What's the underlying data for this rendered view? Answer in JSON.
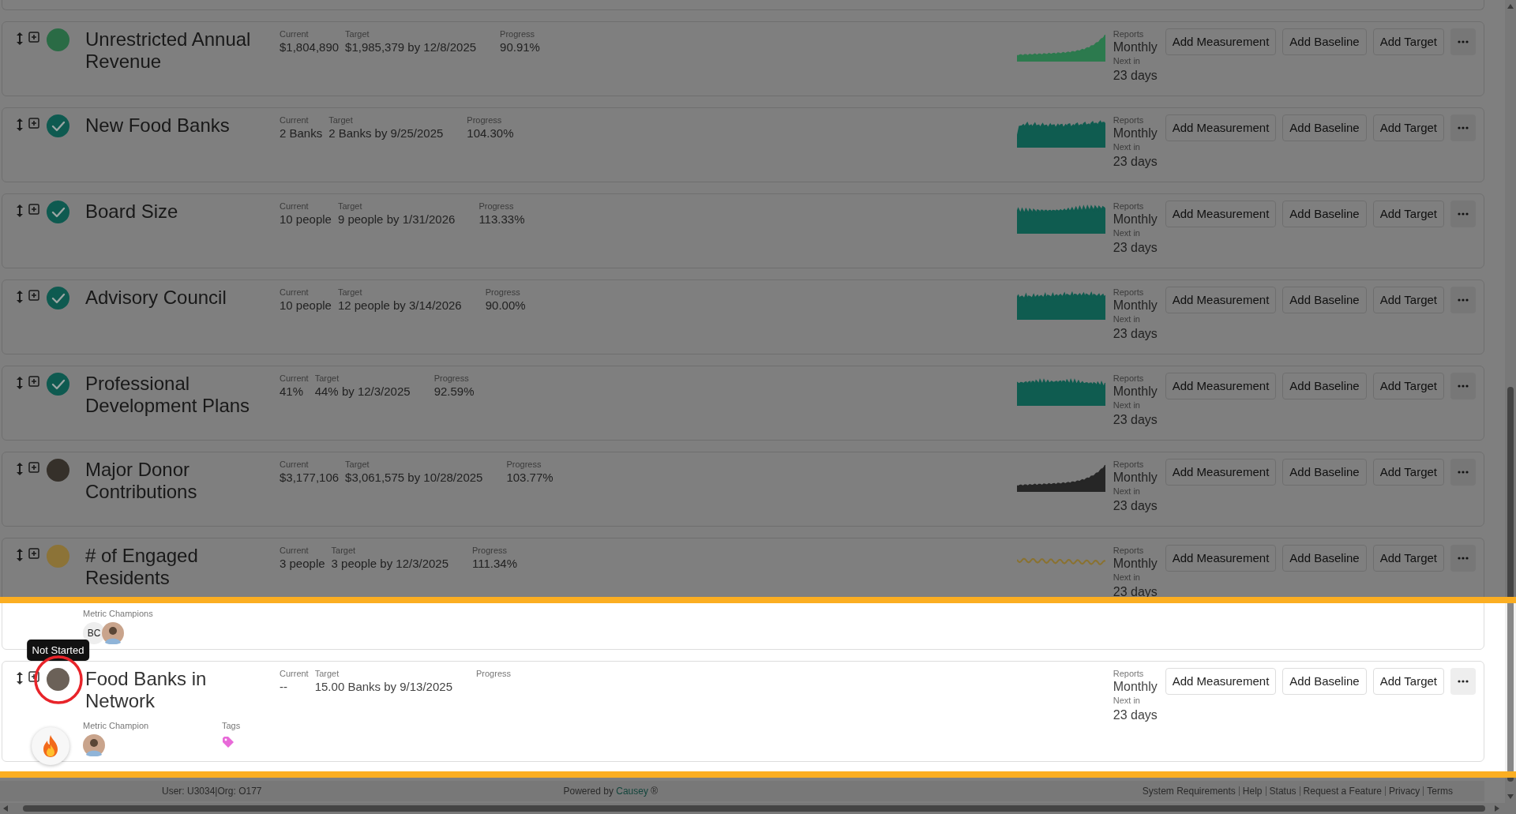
{
  "metrics": [
    {
      "title": "Unrestricted Annual Revenue",
      "status": {
        "color": "#2a6b45",
        "checked": false
      },
      "current_label": "Current",
      "current": "$1,804,890",
      "target_label": "Target",
      "target": "$1,985,379 by 12/8/2025",
      "progress_label": "Progress",
      "progress": "90.91%",
      "sparkline": {
        "kind": "area",
        "color": "#2c7a4e"
      },
      "reports_label": "Reports",
      "frequency": "Monthly",
      "next_label": "Next in",
      "next": "23 days",
      "buttons": [
        "Add Measurement",
        "Add Baseline",
        "Add Target"
      ]
    },
    {
      "title": "New Food Banks",
      "status": {
        "color": "#0e5a50",
        "checked": true
      },
      "current_label": "Current",
      "current": "2 Banks",
      "target_label": "Target",
      "target": "2 Banks by 9/25/2025",
      "progress_label": "Progress",
      "progress": "104.30%",
      "sparkline": {
        "kind": "area",
        "color": "#0f5c50"
      },
      "reports_label": "Reports",
      "frequency": "Monthly",
      "next_label": "Next in",
      "next": "23 days",
      "buttons": [
        "Add Measurement",
        "Add Baseline",
        "Add Target"
      ]
    },
    {
      "title": "Board Size",
      "status": {
        "color": "#0e5a50",
        "checked": true
      },
      "current_label": "Current",
      "current": "10 people",
      "target_label": "Target",
      "target": "9 people by 1/31/2026",
      "progress_label": "Progress",
      "progress": "113.33%",
      "sparkline": {
        "kind": "area",
        "color": "#0f5c50"
      },
      "reports_label": "Reports",
      "frequency": "Monthly",
      "next_label": "Next in",
      "next": "23 days",
      "buttons": [
        "Add Measurement",
        "Add Baseline",
        "Add Target"
      ]
    },
    {
      "title": "Advisory Council",
      "status": {
        "color": "#0e5a50",
        "checked": true
      },
      "current_label": "Current",
      "current": "10 people",
      "target_label": "Target",
      "target": "12 people by 3/14/2026",
      "progress_label": "Progress",
      "progress": "90.00%",
      "sparkline": {
        "kind": "area",
        "color": "#0f5c50"
      },
      "reports_label": "Reports",
      "frequency": "Monthly",
      "next_label": "Next in",
      "next": "23 days",
      "buttons": [
        "Add Measurement",
        "Add Baseline",
        "Add Target"
      ]
    },
    {
      "title": "Professional Development Plans",
      "status": {
        "color": "#0e5a50",
        "checked": true
      },
      "current_label": "Current",
      "current": "41%",
      "target_label": "Target",
      "target": "44% by 12/3/2025",
      "progress_label": "Progress",
      "progress": "92.59%",
      "sparkline": {
        "kind": "area",
        "color": "#0f5c50"
      },
      "reports_label": "Reports",
      "frequency": "Monthly",
      "next_label": "Next in",
      "next": "23 days",
      "buttons": [
        "Add Measurement",
        "Add Baseline",
        "Add Target"
      ]
    },
    {
      "title": "Major Donor Contributions",
      "status": {
        "color": "#35302a",
        "checked": false
      },
      "current_label": "Current",
      "current": "$3,177,106",
      "target_label": "Target",
      "target": "$3,061,575 by 10/28/2025",
      "progress_label": "Progress",
      "progress": "103.77%",
      "sparkline": {
        "kind": "area",
        "color": "#262626"
      },
      "reports_label": "Reports",
      "frequency": "Monthly",
      "next_label": "Next in",
      "next": "23 days",
      "buttons": [
        "Add Measurement",
        "Add Baseline",
        "Add Target"
      ]
    },
    {
      "title": "# of Engaged Residents",
      "status": {
        "color": "#8c7337",
        "checked": false
      },
      "current_label": "Current",
      "current": "3 people",
      "target_label": "Target",
      "target": "3 people by 12/3/2025",
      "progress_label": "Progress",
      "progress": "111.34%",
      "sparkline": {
        "kind": "line",
        "color": "#8a7230"
      },
      "reports_label": "Reports",
      "frequency": "Monthly",
      "next_label": "Next in",
      "next": "23 days",
      "buttons": [
        "Add Measurement",
        "Add Baseline",
        "Add Target"
      ],
      "champions": {
        "label": "Metric Champions",
        "avatars": [
          {
            "kind": "initials",
            "text": "BC"
          },
          {
            "kind": "photo"
          }
        ]
      }
    },
    {
      "title": "Food Banks in Network",
      "status": {
        "color": "#6b6158",
        "checked": false,
        "tooltip": "Not Started",
        "annotated": true
      },
      "current_label": "Current",
      "current": "--",
      "target_label": "Target",
      "target": "15.00 Banks by 9/13/2025",
      "progress_label": "Progress",
      "reports_label": "Reports",
      "frequency": "Monthly",
      "next_label": "Next in",
      "next": "23 days",
      "buttons": [
        "Add Measurement",
        "Add Baseline",
        "Add Target"
      ],
      "champions": {
        "label": "Metric Champion",
        "avatars": [
          {
            "kind": "photo"
          }
        ]
      },
      "tags": {
        "label": "Tags"
      },
      "spotlight": true
    }
  ],
  "footer": {
    "user": "User: U3034|Org: O177",
    "powered_prefix": "Powered by",
    "powered_link": "Causey",
    "powered_suffix": "®",
    "links": [
      "System Requirements",
      "Help",
      "Status",
      "Request a Feature",
      "Privacy",
      "Terms"
    ]
  }
}
